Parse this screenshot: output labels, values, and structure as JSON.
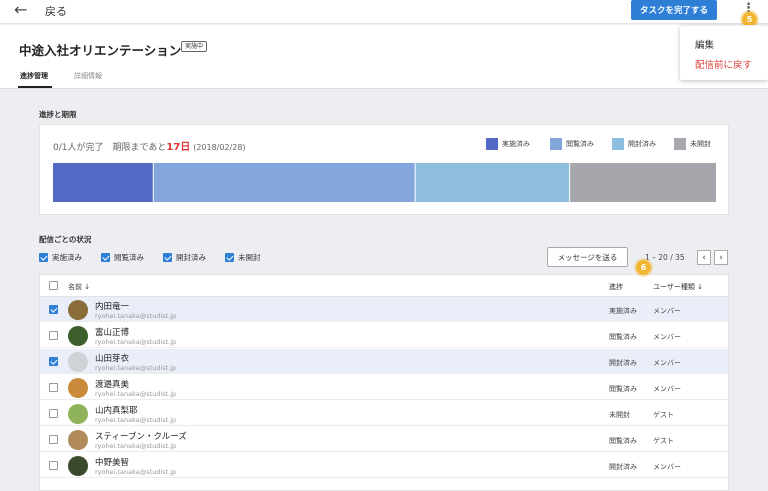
{
  "topbar": {
    "back_label": "戻る",
    "complete_button": "タスクを完了する",
    "kebab": "⋮",
    "badge": "5"
  },
  "dropdown": {
    "edit": "編集",
    "revert": "配信前に戻す"
  },
  "header": {
    "title": "中途入社オリエンテーション",
    "status": "実施中",
    "tabs": [
      "進捗管理",
      "詳細情報"
    ]
  },
  "progress": {
    "section_label": "進捗と期限",
    "summary_prefix": "0/1人が完了　期限まであと",
    "days_left": "17日",
    "deadline": "(2018/02/28)",
    "legend": [
      {
        "label": "実施済み",
        "color": "#5468c6"
      },
      {
        "label": "閲覧済み",
        "color": "#84a6dc"
      },
      {
        "label": "開封済み",
        "color": "#8dbedd"
      },
      {
        "label": "未開封",
        "color": "#a6a7ad"
      }
    ],
    "segments": [
      {
        "share": 0.152,
        "color": "#5468c6"
      },
      {
        "share": 0.395,
        "color": "#84a6dc"
      },
      {
        "share": 0.233,
        "color": "#8dbedd"
      },
      {
        "share": 0.22,
        "color": "#a6a7ad"
      }
    ]
  },
  "delivery": {
    "section_label": "配信ごとの状況",
    "filters": [
      "実施済み",
      "閲覧済み",
      "開封済み",
      "未開封"
    ],
    "send_button": "メッセージを送る",
    "pager": "1 – 20 / 35",
    "pager_prev": "‹",
    "pager_next": "›",
    "badge": "6",
    "columns": {
      "name": "名前",
      "progress": "進捗",
      "user_type": "ユーザー種類"
    },
    "sort_arrow": "↓",
    "rows": [
      {
        "name": "内田竜一",
        "email": "ryohei.tanaka@studist.jp",
        "status": "実施済み",
        "type": "メンバー",
        "selected": true,
        "avatar": "#8a6d3b"
      },
      {
        "name": "富山正博",
        "email": "ryohei.tanaka@studist.jp",
        "status": "閲覧済み",
        "type": "メンバー",
        "selected": false,
        "avatar": "#3c5e2a"
      },
      {
        "name": "山田芽衣",
        "email": "ryohei.tanaka@studist.jp",
        "status": "開封済み",
        "type": "メンバー",
        "selected": true,
        "avatar": "#cfd3d8"
      },
      {
        "name": "渡邉真美",
        "email": "ryohei.tanaka@studist.jp",
        "status": "閲覧済み",
        "type": "メンバー",
        "selected": false,
        "avatar": "#c98a3c"
      },
      {
        "name": "山内真梨耶",
        "email": "ryohei.tanaka@studist.jp",
        "status": "未開封",
        "type": "ゲスト",
        "selected": false,
        "avatar": "#8fb35a"
      },
      {
        "name": "スティーブン・クルーズ",
        "email": "ryohei.tanaka@studist.jp",
        "status": "閲覧済み",
        "type": "ゲスト",
        "selected": false,
        "avatar": "#b08a5a"
      },
      {
        "name": "中野美智",
        "email": "ryohei.tanaka@studist.jp",
        "status": "開封済み",
        "type": "メンバー",
        "selected": false,
        "avatar": "#3a4a2a"
      }
    ]
  }
}
